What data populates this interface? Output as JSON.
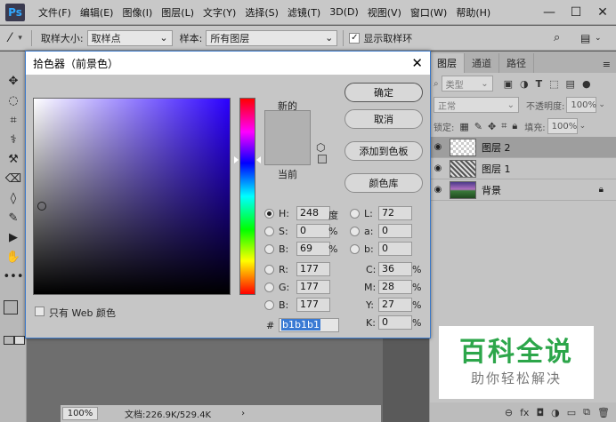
{
  "menubar": {
    "logo": "Ps",
    "items": [
      "文件(F)",
      "编辑(E)",
      "图像(I)",
      "图层(L)",
      "文字(Y)",
      "选择(S)",
      "滤镜(T)",
      "3D(D)",
      "视图(V)",
      "窗口(W)",
      "帮助(H)"
    ],
    "min": "—",
    "max": "☐",
    "close": "✕"
  },
  "options": {
    "sample_size_label": "取样大小:",
    "sample_size_value": "取样点",
    "sample_label": "样本:",
    "sample_value": "所有图层",
    "show_ring_label": "显示取样环"
  },
  "tools": [
    "✥",
    "◌",
    "⌗",
    "⚕",
    "⚒",
    "⌫",
    "◊",
    "✎",
    "▶",
    "✋",
    "•••"
  ],
  "dialog": {
    "title": "拾色器（前景色）",
    "close": "✕",
    "new_label": "新的",
    "current_label": "当前",
    "ok": "确定",
    "cancel": "取消",
    "add_swatch": "添加到色板",
    "color_library": "颜色库",
    "web_only": "只有 Web 颜色",
    "hsb": [
      {
        "label": "H:",
        "value": "248",
        "unit": "度"
      },
      {
        "label": "S:",
        "value": "0",
        "unit": "%"
      },
      {
        "label": "B:",
        "value": "69",
        "unit": "%"
      }
    ],
    "rgb": [
      {
        "label": "R:",
        "value": "177"
      },
      {
        "label": "G:",
        "value": "177"
      },
      {
        "label": "B:",
        "value": "177"
      }
    ],
    "lab": [
      {
        "label": "L:",
        "value": "72"
      },
      {
        "label": "a:",
        "value": "0"
      },
      {
        "label": "b:",
        "value": "0"
      }
    ],
    "cmyk": [
      {
        "label": "C:",
        "value": "36",
        "unit": "%"
      },
      {
        "label": "M:",
        "value": "28",
        "unit": "%"
      },
      {
        "label": "Y:",
        "value": "27",
        "unit": "%"
      },
      {
        "label": "K:",
        "value": "0",
        "unit": "%"
      }
    ],
    "hash": "#",
    "hex": "b1b1b1",
    "new_color": "#b1b1b1"
  },
  "layers_panel": {
    "tabs": [
      "图层",
      "通道",
      "路径"
    ],
    "filter_kind": "类型",
    "blend_mode": "正常",
    "opacity_label": "不透明度:",
    "opacity_value": "100%",
    "lock_label": "锁定:",
    "fill_label": "填充:",
    "fill_value": "100%",
    "layers": [
      {
        "name": "图层 2"
      },
      {
        "name": "图层 1"
      },
      {
        "name": "背景"
      }
    ],
    "footer_icons": [
      "⊖",
      "fx",
      "◘",
      "◑",
      "▭",
      "⧉",
      "🗑"
    ]
  },
  "status": {
    "zoom": "100%",
    "doc": "文档:226.9K/529.4K"
  },
  "watermark": {
    "title": "百科全说",
    "subtitle": "助你轻松解决"
  }
}
